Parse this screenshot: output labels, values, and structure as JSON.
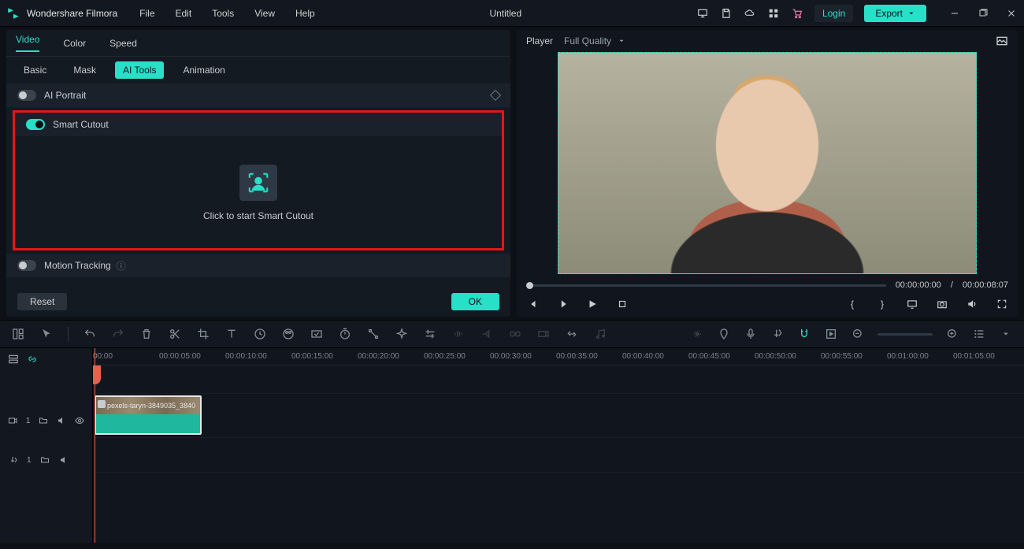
{
  "app": {
    "name": "Wondershare Filmora",
    "title": "Untitled"
  },
  "menu": {
    "file": "File",
    "edit": "Edit",
    "tools": "Tools",
    "view": "View",
    "help": "Help"
  },
  "header": {
    "login": "Login",
    "export": "Export"
  },
  "panel": {
    "tabs1": {
      "video": "Video",
      "color": "Color",
      "speed": "Speed"
    },
    "tabs2": {
      "basic": "Basic",
      "mask": "Mask",
      "aitools": "AI Tools",
      "animation": "Animation"
    },
    "aiportrait": "AI Portrait",
    "smartcutout": "Smart Cutout",
    "smartcutout_hint": "Click to start Smart Cutout",
    "motiontracking": "Motion Tracking",
    "reset": "Reset",
    "ok": "OK"
  },
  "player": {
    "label": "Player",
    "quality": "Full Quality",
    "time_current": "00:00:00:00",
    "time_sep": "/",
    "time_total": "00:00:08:07",
    "brace_l": "{",
    "brace_r": "}"
  },
  "timeline": {
    "labels": [
      "00:00",
      "00:00:05:00",
      "00:00:10:00",
      "00:00:15:00",
      "00:00:20:00",
      "00:00:25:00",
      "00:00:30:00",
      "00:00:35:00",
      "00:00:40:00",
      "00:00:45:00",
      "00:00:50:00",
      "00:00:55:00",
      "00:01:00:00",
      "00:01:05:00"
    ],
    "clip_name": "pexels-taryn-3849035_3840",
    "video_track": "1",
    "audio_track": "1"
  }
}
